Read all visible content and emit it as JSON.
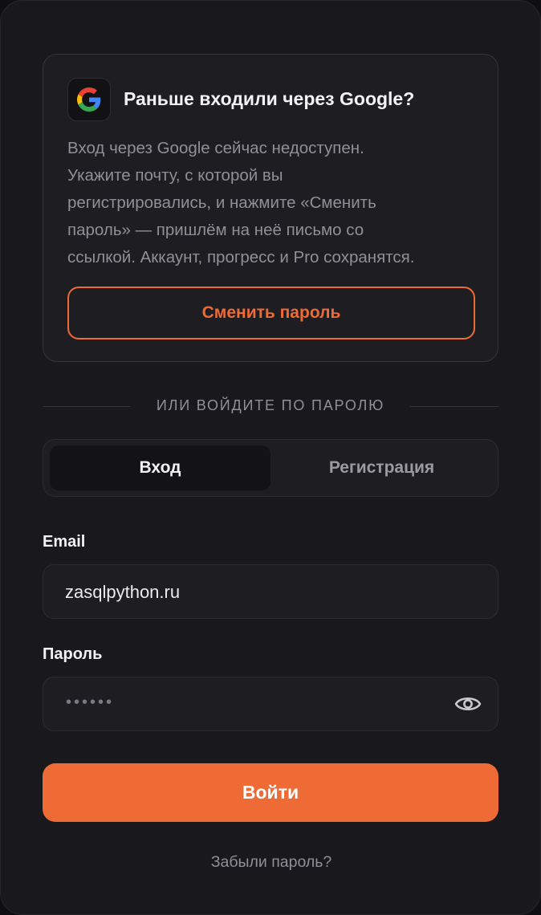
{
  "notice": {
    "icon": "google-logo-icon",
    "title": "Раньше входили через Google?",
    "text_lines": [
      "Вход через Google сейчас недоступен.",
      "Укажите почту, с которой вы",
      "регистрировались, и нажмите «Сменить",
      "пароль» — пришлём на неё письмо со",
      "ссылкой. Аккаунт, прогресс и Pro сохранятся."
    ],
    "button_label": "Сменить пароль"
  },
  "divider_text": "ИЛИ ВОЙДИТЕ ПО ПАРОЛЮ",
  "tabs": [
    {
      "label": "Вход",
      "active": true
    },
    {
      "label": "Регистрация",
      "active": false
    }
  ],
  "form": {
    "email": {
      "label": "Email",
      "value": "zasqlpython.ru"
    },
    "password": {
      "label": "Пароль",
      "value_masked": "••••••",
      "toggle_icon": "eye-icon"
    },
    "submit_label": "Войти",
    "forgot_label": "Забыли пароль?"
  },
  "colors": {
    "accent": "#ee6b35",
    "background": "#19191d",
    "surface": "#1e1e22",
    "text_primary": "#f2f2f4",
    "text_muted": "#8f8f96"
  }
}
